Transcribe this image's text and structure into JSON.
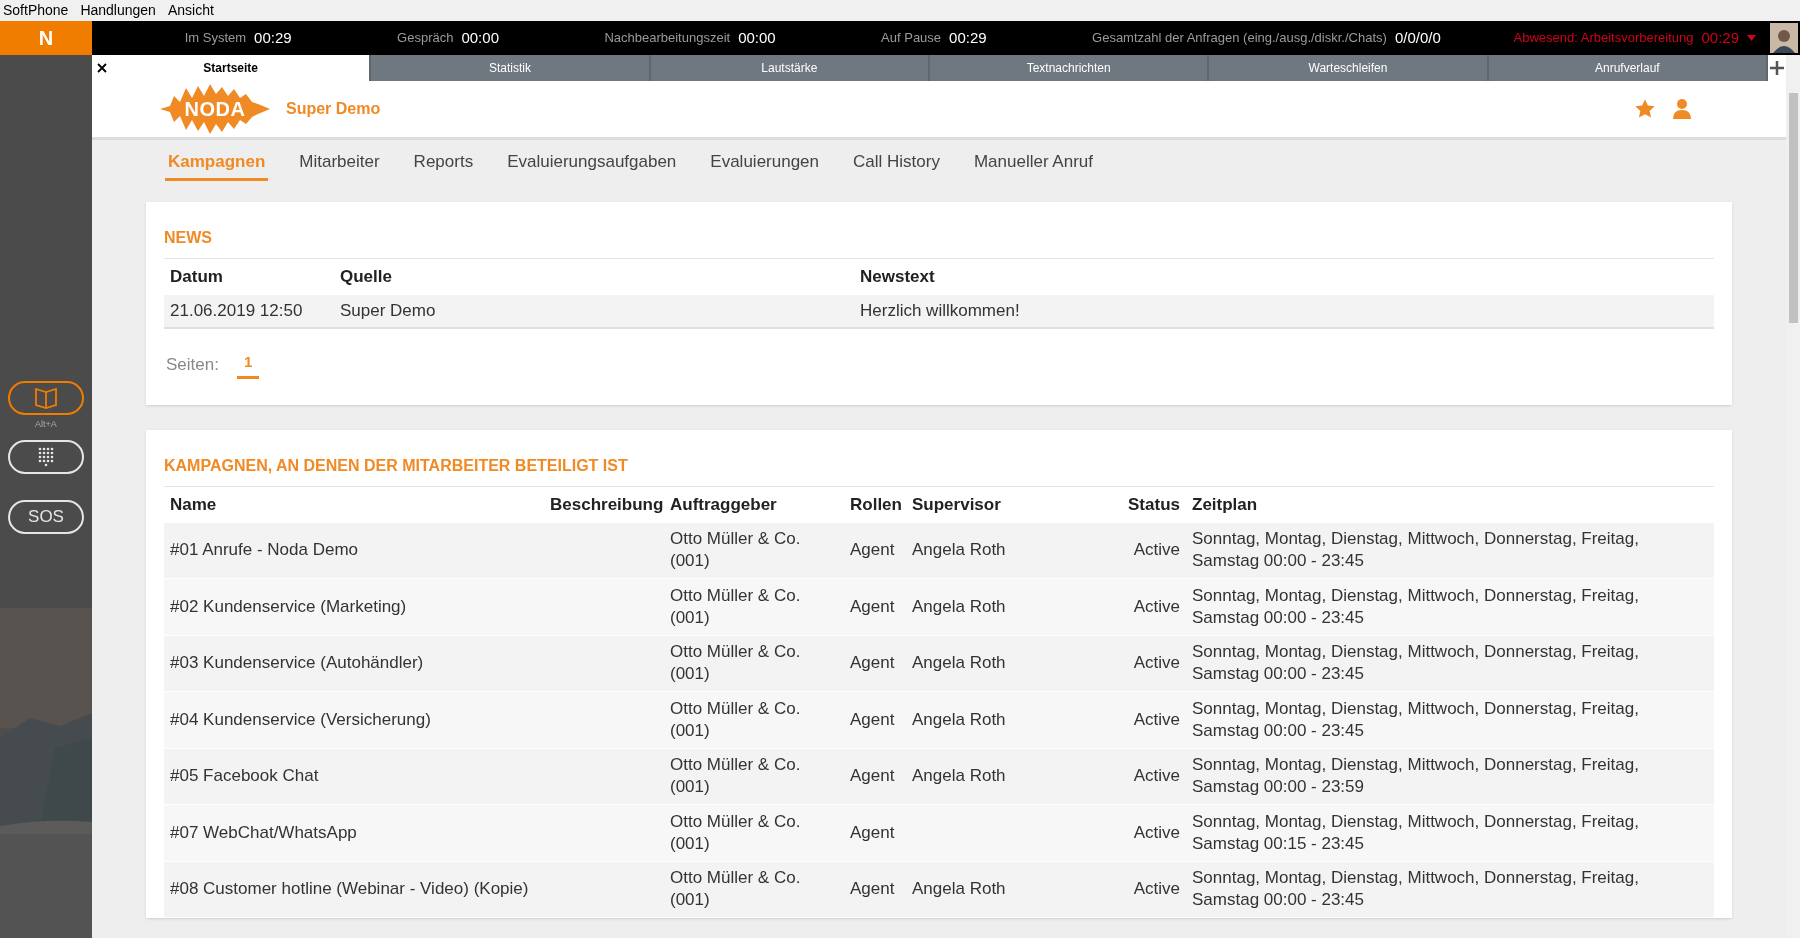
{
  "menu_bar": [
    "SoftPhone",
    "Handlungen",
    "Ansicht"
  ],
  "status_bar": {
    "logo": "N",
    "stats": [
      {
        "label": "Im System",
        "value": "00:29"
      },
      {
        "label": "Gespräch",
        "value": "00:00"
      },
      {
        "label": "Nachbearbeitungszeit",
        "value": "00:00"
      },
      {
        "label": "Auf Pause",
        "value": "00:29"
      },
      {
        "label": "Gesamtzahl der Anfragen (eing./ausg./diskr./Chats)",
        "value": "0/0/0/0"
      }
    ],
    "presence": {
      "label": "Abwesend: Arbeitsvorbereitung",
      "time": "00:29"
    }
  },
  "tabs": [
    {
      "label": "Startseite",
      "selected": true
    },
    {
      "label": "Statistik",
      "selected": false
    },
    {
      "label": "Lautstärke",
      "selected": false
    },
    {
      "label": "Textnachrichten",
      "selected": false
    },
    {
      "label": "Warteschleifen",
      "selected": false
    },
    {
      "label": "Anrufverlauf",
      "selected": false
    }
  ],
  "sidebar": {
    "buttons": [
      {
        "kind": "book",
        "hint": "Alt+A",
        "active": true
      },
      {
        "kind": "keypad",
        "active": false
      },
      {
        "kind": "text",
        "label": "SOS",
        "active": false
      }
    ]
  },
  "header": {
    "logo": "NODA",
    "title": "Super Demo"
  },
  "nav": [
    {
      "label": "Kampagnen",
      "selected": true
    },
    {
      "label": "Mitarbeiter",
      "selected": false
    },
    {
      "label": "Reports",
      "selected": false
    },
    {
      "label": "Evaluierungsaufgaben",
      "selected": false
    },
    {
      "label": "Evaluierungen",
      "selected": false
    },
    {
      "label": "Call History",
      "selected": false
    },
    {
      "label": "Manueller Anruf",
      "selected": false
    }
  ],
  "news": {
    "title": "NEWS",
    "columns": [
      "Datum",
      "Quelle",
      "Newstext"
    ],
    "rows": [
      [
        "21.06.2019 12:50",
        "Super Demo",
        "Herzlich willkommen!"
      ]
    ],
    "pages_label": "Seiten:",
    "pages": [
      {
        "label": "1",
        "selected": true
      }
    ]
  },
  "campaigns": {
    "title": "KAMPAGNEN, AN DENEN DER MITARBEITER BETEILIGT IST",
    "columns": [
      "Name",
      "Beschreibung",
      "Auftraggeber",
      "Rollen",
      "Supervisor",
      "Status",
      "Zeitplan"
    ],
    "rows": [
      [
        "#01 Anrufe - Noda Demo",
        "",
        "Otto Müller & Co. (001)",
        "Agent",
        "Angela Roth",
        "Active",
        "Sonntag, Montag, Dienstag, Mittwoch, Donnerstag, Freitag, Samstag 00:00 - 23:45"
      ],
      [
        "#02 Kundenservice (Marketing)",
        "",
        "Otto Müller & Co. (001)",
        "Agent",
        "Angela Roth",
        "Active",
        "Sonntag, Montag, Dienstag, Mittwoch, Donnerstag, Freitag, Samstag 00:00 - 23:45"
      ],
      [
        "#03 Kundenservice (Autohändler)",
        "",
        "Otto Müller & Co. (001)",
        "Agent",
        "Angela Roth",
        "Active",
        "Sonntag, Montag, Dienstag, Mittwoch, Donnerstag, Freitag, Samstag 00:00 - 23:45"
      ],
      [
        "#04 Kundenservice (Versicherung)",
        "",
        "Otto Müller & Co. (001)",
        "Agent",
        "Angela Roth",
        "Active",
        "Sonntag, Montag, Dienstag, Mittwoch, Donnerstag, Freitag, Samstag 00:00 - 23:45"
      ],
      [
        "#05 Facebook Chat",
        "",
        "Otto Müller & Co. (001)",
        "Agent",
        "Angela Roth",
        "Active",
        "Sonntag, Montag, Dienstag, Mittwoch, Donnerstag, Freitag, Samstag 00:00 - 23:59"
      ],
      [
        "#07 WebChat/WhatsApp",
        "",
        "Otto Müller & Co. (001)",
        "Agent",
        "",
        "Active",
        "Sonntag, Montag, Dienstag, Mittwoch, Donnerstag, Freitag, Samstag 00:15 - 23:45"
      ],
      [
        "#08 Customer hotline (Webinar - Video) (Kopie)",
        "",
        "Otto Müller & Co. (001)",
        "Agent",
        "Angela Roth",
        "Active",
        "Sonntag, Montag, Dienstag, Mittwoch, Donnerstag, Freitag, Samstag 00:00 - 23:45"
      ]
    ]
  }
}
